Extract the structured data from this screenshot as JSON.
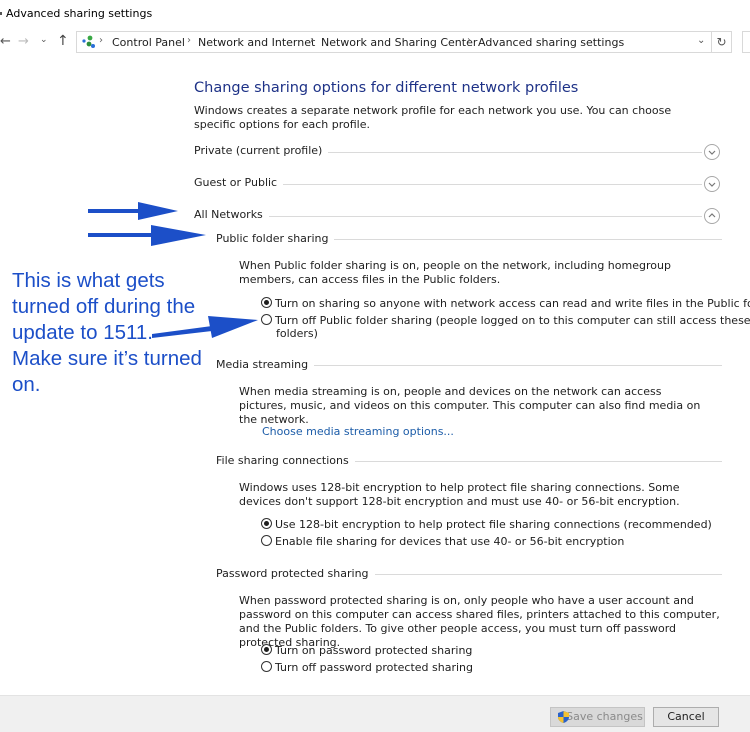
{
  "window": {
    "title": "Advanced sharing settings"
  },
  "nav": {
    "back_icon": "back-arrow-icon",
    "forward_icon": "forward-arrow-icon",
    "recent_icon": "chevron-down-icon",
    "up_icon": "up-arrow-icon",
    "breadcrumb": [
      "Control Panel",
      "Network and Internet",
      "Network and Sharing Center",
      "Advanced sharing settings"
    ],
    "refresh_icon": "refresh-icon"
  },
  "main": {
    "heading": "Change sharing options for different network profiles",
    "intro": "Windows creates a separate network profile for each network you use. You can choose specific options for each profile.",
    "profiles": [
      {
        "label": "Private (current profile)",
        "expanded": false
      },
      {
        "label": "Guest or Public",
        "expanded": false
      },
      {
        "label": "All Networks",
        "expanded": true
      }
    ],
    "sections": {
      "public_folder": {
        "title": "Public folder sharing",
        "description": "When Public folder sharing is on, people on the network, including homegroup members, can access files in the Public folders.",
        "options": [
          {
            "label": "Turn on sharing so anyone with network access can read and write files in the Public folders",
            "selected": true
          },
          {
            "label": "Turn off Public folder sharing (people logged on to this computer can still access these",
            "label_line2": "folders)",
            "selected": false
          }
        ]
      },
      "media_streaming": {
        "title": "Media streaming",
        "description": "When media streaming is on, people and devices on the network can access pictures, music, and videos on this computer. This computer can also find media on the network.",
        "link": "Choose media streaming options..."
      },
      "file_sharing": {
        "title": "File sharing connections",
        "description": "Windows uses 128-bit encryption to help protect file sharing connections. Some devices don't support 128-bit encryption and must use 40- or 56-bit encryption.",
        "options": [
          {
            "label": "Use 128-bit encryption to help protect file sharing connections (recommended)",
            "selected": true
          },
          {
            "label": "Enable file sharing for devices that use 40- or 56-bit encryption",
            "selected": false
          }
        ]
      },
      "password": {
        "title": "Password protected sharing",
        "description": "When password protected sharing is on, only people who have a user account and password on this computer can access shared files, printers attached to this computer, and the Public folders. To give other people access, you must turn off password protected sharing.",
        "options": [
          {
            "label": "Turn on password protected sharing",
            "selected": true
          },
          {
            "label": "Turn off password protected sharing",
            "selected": false
          }
        ]
      }
    }
  },
  "footer": {
    "save_label": "Save changes",
    "cancel_label": "Cancel"
  },
  "annotation": {
    "text": "This is what gets turned off during the update to 1511. Make sure it’s turned on.",
    "color": "#1c4fc8"
  }
}
